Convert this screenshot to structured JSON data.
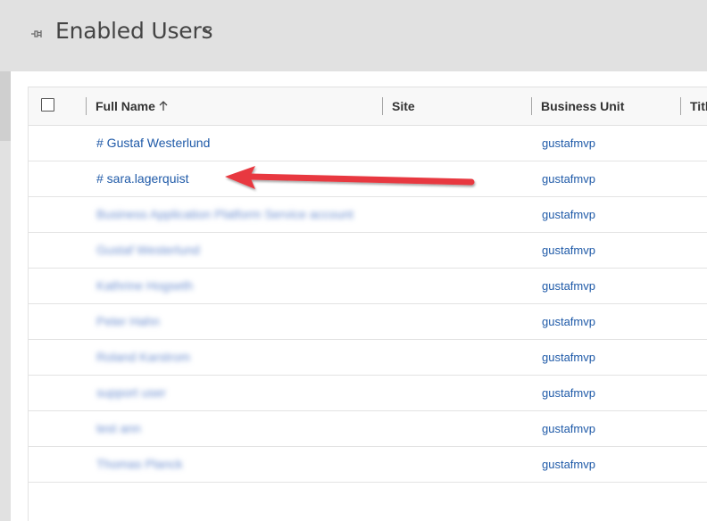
{
  "header": {
    "title": "Enabled Users",
    "pin_icon": "pin-icon",
    "dropdown_icon": "chevron-down-icon"
  },
  "grid": {
    "columns": [
      {
        "key": "full_name",
        "label": "Full Name",
        "sort": "ascending"
      },
      {
        "key": "site",
        "label": "Site"
      },
      {
        "key": "business_unit",
        "label": "Business Unit"
      },
      {
        "key": "title",
        "label": "Title"
      }
    ],
    "rows": [
      {
        "full_name": "# Gustaf Westerlund",
        "business_unit": "gustafmvp"
      },
      {
        "full_name": "# sara.lagerquist",
        "business_unit": "gustafmvp"
      },
      {
        "full_name": "Business Application Platform Service account",
        "business_unit": "gustafmvp",
        "blurred": true
      },
      {
        "full_name": "Gustaf Westerlund",
        "business_unit": "gustafmvp",
        "blurred": true
      },
      {
        "full_name": "Kathrine Hogseth",
        "business_unit": "gustafmvp",
        "blurred": true
      },
      {
        "full_name": "Peter Hahn",
        "business_unit": "gustafmvp",
        "blurred": true
      },
      {
        "full_name": "Roland Karstrom",
        "business_unit": "gustafmvp",
        "blurred": true
      },
      {
        "full_name": "support user",
        "business_unit": "gustafmvp",
        "blurred": true
      },
      {
        "full_name": "test ann",
        "business_unit": "gustafmvp",
        "blurred": true
      },
      {
        "full_name": "Thomas Planck",
        "business_unit": "gustafmvp",
        "blurred": true
      }
    ]
  },
  "annotation": {
    "color": "#e8393f",
    "type": "arrow"
  },
  "colors": {
    "link": "#1f5aa8",
    "header_bg": "#e1e1e1",
    "grid_header_bg": "#f8f8f8"
  }
}
